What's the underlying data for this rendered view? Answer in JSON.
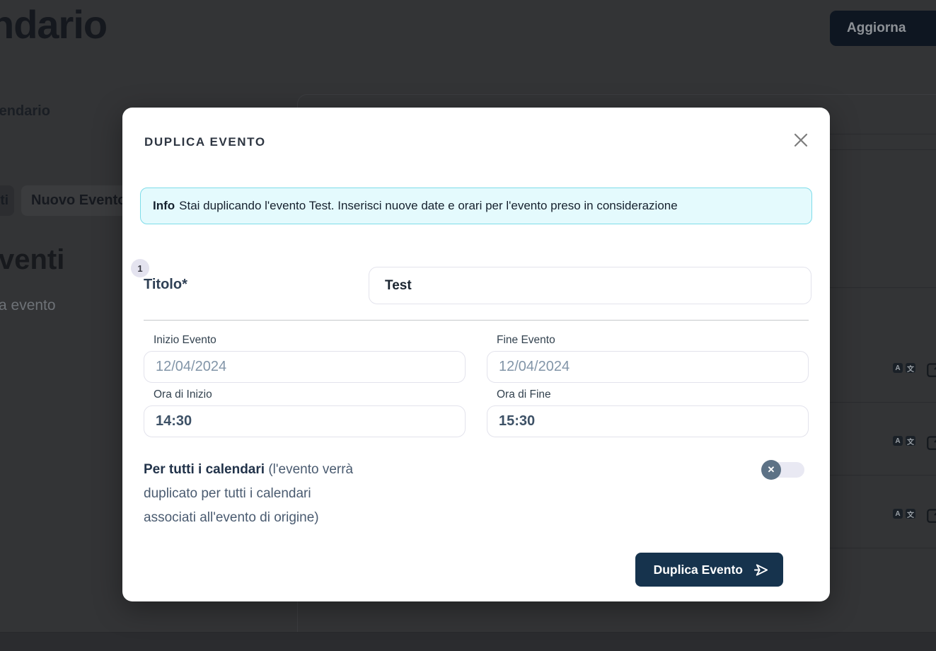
{
  "backdrop": {
    "page_title_fragment": "ndario",
    "nav_tab_fragment": "alendario",
    "update_button_label": "Aggiorna",
    "filter_button_fragment": "ti",
    "new_event_button_label": "Nuovo Evento",
    "section_heading_fragment": "venti",
    "search_text_fragment": "a evento",
    "row_icons": {
      "translate_a": "A",
      "translate_zh": "文"
    }
  },
  "modal": {
    "title": "DUPLICA EVENTO",
    "info": {
      "label": "Info",
      "message": "Stai duplicando l'evento Test. Inserisci nuove date e orari per l'evento preso in considerazione"
    },
    "step_badge": "1",
    "fields": {
      "title": {
        "label": "Titolo*",
        "value": "Test"
      },
      "start_date": {
        "label": "Inizio Evento",
        "value": "12/04/2024"
      },
      "end_date": {
        "label": "Fine Evento",
        "value": "12/04/2024"
      },
      "start_time": {
        "label": "Ora di Inizio",
        "value": "14:30"
      },
      "end_time": {
        "label": "Ora di Fine",
        "value": "15:30"
      }
    },
    "all_calendars": {
      "label_bold": "Per tutti i calendari",
      "label_rest": " (l'evento verrà duplicato per tutti i calendari associati all'evento di origine)",
      "toggle_state": "off",
      "knob_icon": "✕"
    },
    "submit_button_label": "Duplica Evento"
  },
  "colors": {
    "accent_navy": "#16334d",
    "info_bg": "#e4fafd",
    "info_border": "#7edce9",
    "toggle_knob": "#5d7286",
    "overlay": "#333436"
  }
}
